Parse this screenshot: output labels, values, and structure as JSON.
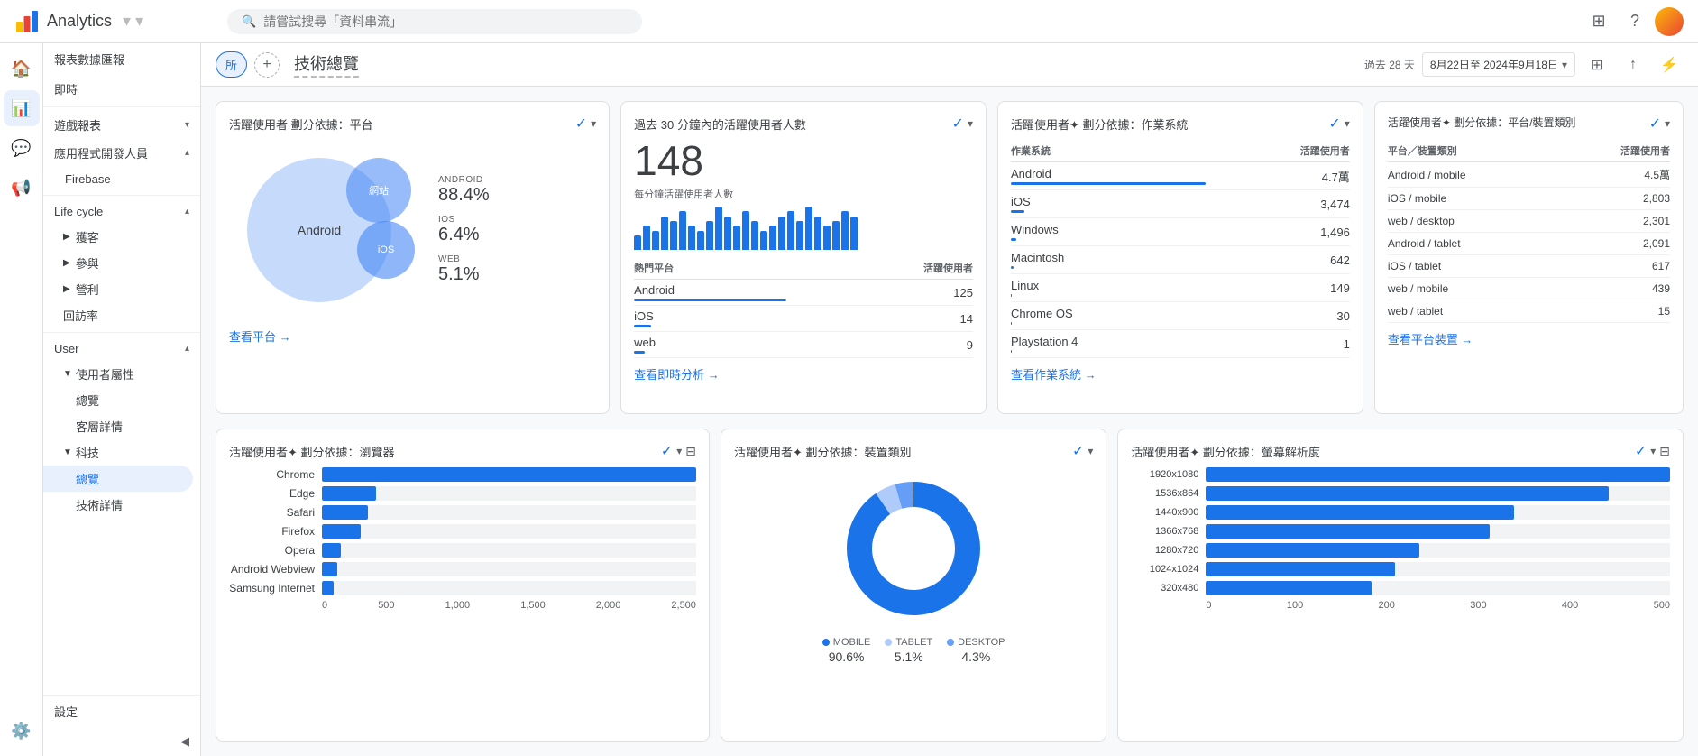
{
  "app": {
    "title": "Analytics",
    "search_placeholder": "請嘗試搜尋「資料串流」"
  },
  "topbar": {
    "date_range_label": "過去 28 天",
    "date_range": "8月22日至 2024年9月18日"
  },
  "page": {
    "title": "技術總覽",
    "filter_label": "所"
  },
  "sidebar": {
    "reports_summary": "報表數據匯報",
    "instant": "即時",
    "games_reports": "遊戲報表",
    "app_dev": "應用程式開發人員",
    "firebase": "Firebase",
    "lifecycle": "Life cycle",
    "acquire": "獲客",
    "engage": "參與",
    "revenue": "營利",
    "bounce_rate": "回訪率",
    "user": "User",
    "user_attributes": "使用者屬性",
    "overview": "總覽",
    "customer_details": "客層詳情",
    "tech": "科技",
    "tech_overview": "總覽",
    "tech_details": "技術詳情",
    "settings": "設定"
  },
  "cards": {
    "platform_card": {
      "title": "活躍使用者 劃分依據：平台",
      "android_label": "ANDROID",
      "android_value": "88.4%",
      "ios_label": "IOS",
      "ios_value": "6.4%",
      "web_label": "WEB",
      "web_value": "5.1%",
      "view_link": "查看平台 →",
      "android_circle_label": "Android",
      "web_circle_label": "網站",
      "ios_circle_label": "iOS"
    },
    "active_users_card": {
      "title": "過去 30 分鐘內的活躍使用者人數",
      "count": "148",
      "sub_label": "每分鐘活躍使用者人數",
      "table_header_platform": "熱門平台",
      "table_header_users": "活躍使用者",
      "rows": [
        {
          "platform": "Android",
          "users": "125",
          "bar_pct": 100
        },
        {
          "platform": "iOS",
          "users": "14",
          "bar_pct": 11
        },
        {
          "platform": "web",
          "users": "9",
          "bar_pct": 7
        }
      ],
      "view_link": "查看即時分析 →"
    },
    "os_card": {
      "title": "活躍使用者✦ 劃分依據：作業系統",
      "col_os": "作業系統",
      "col_users": "活躍使用者",
      "rows": [
        {
          "os": "Android",
          "users": "4.7萬",
          "bar_pct": 100
        },
        {
          "os": "iOS",
          "users": "3,474",
          "bar_pct": 7
        },
        {
          "os": "Windows",
          "users": "1,496",
          "bar_pct": 3
        },
        {
          "os": "Macintosh",
          "users": "642",
          "bar_pct": 1.5
        },
        {
          "os": "Linux",
          "users": "149",
          "bar_pct": 0.5
        },
        {
          "os": "Chrome OS",
          "users": "30",
          "bar_pct": 0.1
        },
        {
          "os": "Playstation 4",
          "users": "1",
          "bar_pct": 0.05
        }
      ],
      "view_link": "查看作業系統 →"
    },
    "platform_device_card": {
      "title": "活躍使用者✦ 劃分依據：平台/裝置類別",
      "col_type": "平台／裝置類別",
      "col_users": "活躍使用者",
      "rows": [
        {
          "type": "Android / mobile",
          "users": "4.5萬"
        },
        {
          "type": "iOS / mobile",
          "users": "2,803"
        },
        {
          "type": "web / desktop",
          "users": "2,301"
        },
        {
          "type": "Android / tablet",
          "users": "2,091"
        },
        {
          "type": "iOS / tablet",
          "users": "617"
        },
        {
          "type": "web / mobile",
          "users": "439"
        },
        {
          "type": "web / tablet",
          "users": "15"
        }
      ],
      "view_link": "查看平台裝置 →"
    },
    "browser_card": {
      "title": "活躍使用者✦ 劃分依據：瀏覽器",
      "rows": [
        {
          "name": "Chrome",
          "bar_pct": 97
        },
        {
          "name": "Edge",
          "bar_pct": 14
        },
        {
          "name": "Safari",
          "bar_pct": 12
        },
        {
          "name": "Firefox",
          "bar_pct": 10
        },
        {
          "name": "Opera",
          "bar_pct": 5
        },
        {
          "name": "Android Webview",
          "bar_pct": 4
        },
        {
          "name": "Samsung Internet",
          "bar_pct": 3
        }
      ],
      "x_labels": [
        "0",
        "500",
        "1,000",
        "1,500",
        "2,000",
        "2,500"
      ]
    },
    "device_type_card": {
      "title": "活躍使用者✦ 劃分依據：裝置類別",
      "mobile_label": "MOBILE",
      "mobile_value": "90.6%",
      "tablet_label": "TABLET",
      "tablet_value": "5.1%",
      "desktop_label": "DESKTOP",
      "desktop_value": "4.3%"
    },
    "resolution_card": {
      "title": "活躍使用者✦ 劃分依據：螢幕解析度",
      "rows": [
        {
          "name": "1920x1080",
          "bar_pct": 98
        },
        {
          "name": "1536x864",
          "bar_pct": 85
        },
        {
          "name": "1440x900",
          "bar_pct": 65
        },
        {
          "name": "1366x768",
          "bar_pct": 60
        },
        {
          "name": "1280x720",
          "bar_pct": 45
        },
        {
          "name": "1024x1024",
          "bar_pct": 40
        },
        {
          "name": "320x480",
          "bar_pct": 35
        }
      ],
      "x_labels": [
        "0",
        "100",
        "200",
        "300",
        "400",
        "500"
      ]
    }
  },
  "mini_bars": [
    3,
    5,
    4,
    7,
    6,
    8,
    5,
    4,
    6,
    9,
    7,
    5,
    8,
    6,
    4,
    5,
    7,
    8,
    6,
    9,
    7,
    5,
    6,
    8,
    7
  ]
}
